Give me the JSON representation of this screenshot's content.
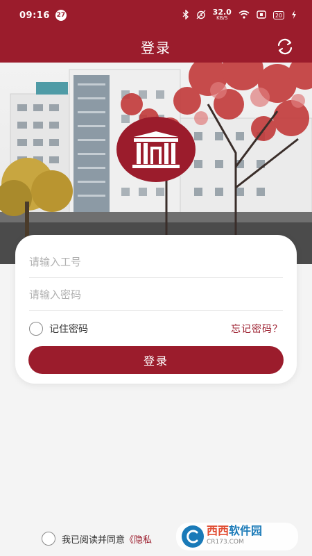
{
  "status_bar": {
    "time": "09:16",
    "notification_count": "27",
    "net_speed": "32.0",
    "net_unit": "KB/S",
    "battery": "20"
  },
  "header": {
    "title": "登录"
  },
  "login": {
    "id_placeholder": "请输入工号",
    "password_placeholder": "请输入密码",
    "remember_label": "记住密码",
    "forgot_label": "忘记密码？",
    "submit_label": "登录"
  },
  "agreement": {
    "text": "我已阅读并同意",
    "link": "《隐私"
  },
  "watermark": {
    "title_a": "西西",
    "title_b": "软件园",
    "url": "CR173.COM"
  },
  "colors": {
    "brand": "#9b1c2c",
    "background": "#f4f4f4"
  },
  "icons": [
    "bluetooth-icon",
    "alarm-icon",
    "wifi-icon",
    "sim-icon",
    "battery-icon",
    "refresh-icon",
    "hospital-logo-icon"
  ]
}
